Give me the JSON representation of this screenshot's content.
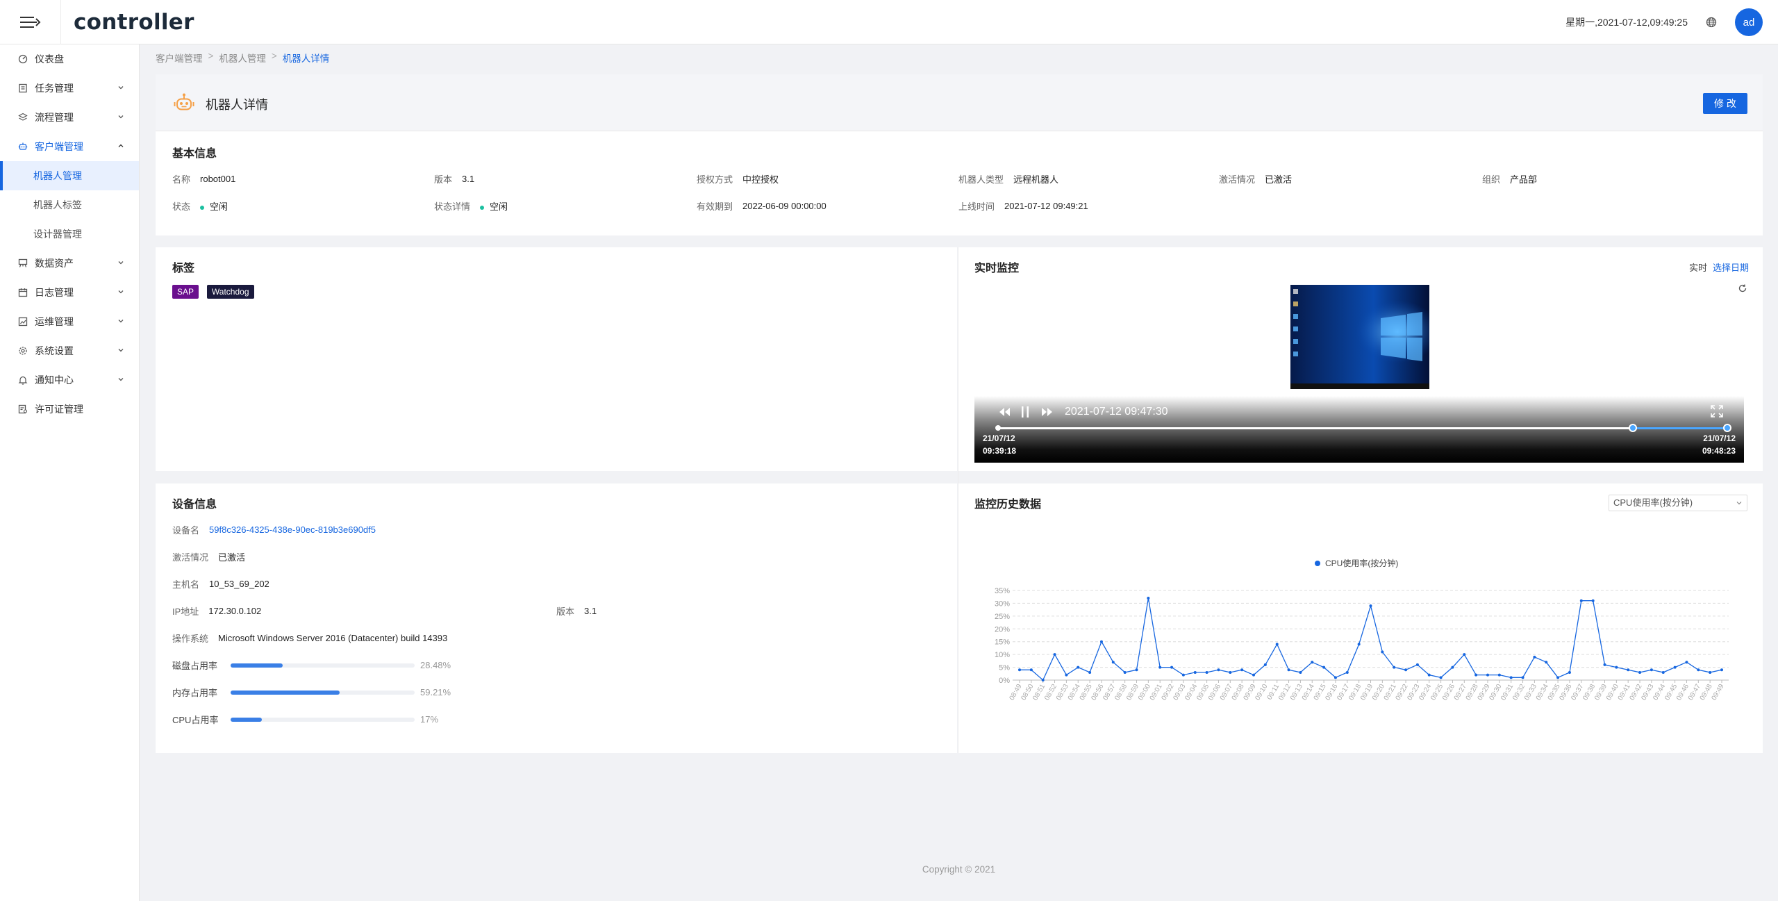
{
  "app": {
    "logo": "controller",
    "datetime": "星期一,2021-07-12,09:49:25",
    "avatar": "ad"
  },
  "sidebar": {
    "items": [
      {
        "label": "仪表盘"
      },
      {
        "label": "任务管理"
      },
      {
        "label": "流程管理"
      },
      {
        "label": "客户端管理"
      },
      {
        "label": "数据资产"
      },
      {
        "label": "日志管理"
      },
      {
        "label": "运维管理"
      },
      {
        "label": "系统设置"
      },
      {
        "label": "通知中心"
      },
      {
        "label": "许可证管理"
      }
    ],
    "subitems": [
      {
        "label": "机器人管理"
      },
      {
        "label": "机器人标签"
      },
      {
        "label": "设计器管理"
      }
    ]
  },
  "breadcrumb": {
    "level1": "客户端管理",
    "level2": "机器人管理",
    "current": "机器人详情",
    "sep": ">"
  },
  "header": {
    "title": "机器人详情",
    "edit_label": "修 改"
  },
  "basic": {
    "title": "基本信息",
    "name_k": "名称",
    "name_v": "robot001",
    "version_k": "版本",
    "version_v": "3.1",
    "auth_k": "授权方式",
    "auth_v": "中控授权",
    "type_k": "机器人类型",
    "type_v": "远程机器人",
    "activation_k": "激活情况",
    "activation_v": "已激活",
    "org_k": "组织",
    "org_v": "产品部",
    "status_k": "状态",
    "status_v": "空闲",
    "status_detail_k": "状态详情",
    "status_detail_v": "空闲",
    "expire_k": "有效期到",
    "expire_v": "2022-06-09 00:00:00",
    "online_k": "上线时间",
    "online_v": "2021-07-12 09:49:21"
  },
  "tags": {
    "title": "标签",
    "items": [
      {
        "label": "SAP",
        "color": "#6a0f8e"
      },
      {
        "label": "Watchdog",
        "color": "#1a1a3d"
      }
    ]
  },
  "monitor": {
    "title": "实时监控",
    "realtime_label": "实时",
    "choose_date_label": "选择日期",
    "player_time": "2021-07-12 09:47:30",
    "start_date": "21/07/12",
    "start_time": "09:39:18",
    "end_date": "21/07/12",
    "end_time": "09:48:23",
    "position": 0.87
  },
  "device": {
    "title": "设备信息",
    "name_k": "设备名",
    "name_v": "59f8c326-4325-438e-90ec-819b3e690df5",
    "activation_k": "激活情况",
    "activation_v": "已激活",
    "host_k": "主机名",
    "host_v": "10_53_69_202",
    "ip_k": "IP地址",
    "ip_v": "172.30.0.102",
    "version_k": "版本",
    "version_v": "3.1",
    "os_k": "操作系统",
    "os_v": "Microsoft Windows Server 2016 (Datacenter) build 14393",
    "disk_k": "磁盘占用率",
    "disk_pct": 28.48,
    "disk_label": "28.48%",
    "mem_k": "内存占用率",
    "mem_pct": 59.21,
    "mem_label": "59.21%",
    "cpu_k": "CPU占用率",
    "cpu_pct": 17,
    "cpu_label": "17%"
  },
  "history": {
    "title": "监控历史数据",
    "select_value": "CPU使用率(按分钟)"
  },
  "chart_data": {
    "type": "line",
    "legend": "CPU使用率(按分钟)",
    "legend_position": "top-center",
    "ylim": [
      0,
      35
    ],
    "yticks": [
      "35%",
      "30%",
      "25%",
      "20%",
      "15%",
      "10%",
      "5%",
      "0%"
    ],
    "grid": true,
    "color": "#1666e0",
    "x": [
      "08:49",
      "08:50",
      "08:51",
      "08:52",
      "08:53",
      "08:54",
      "08:55",
      "08:56",
      "08:57",
      "08:58",
      "08:59",
      "09:00",
      "09:01",
      "09:02",
      "09:03",
      "09:04",
      "09:05",
      "09:06",
      "09:07",
      "09:08",
      "09:09",
      "09:10",
      "09:11",
      "09:12",
      "09:13",
      "09:14",
      "09:15",
      "09:16",
      "09:17",
      "09:18",
      "09:19",
      "09:20",
      "09:21",
      "09:22",
      "09:23",
      "09:24",
      "09:25",
      "09:26",
      "09:27",
      "09:28",
      "09:29",
      "09:30",
      "09:31",
      "09:32",
      "09:33",
      "09:34",
      "09:35",
      "09:36",
      "09:37",
      "09:38",
      "09:39",
      "09:40",
      "09:41",
      "09:42",
      "09:43",
      "09:44",
      "09:45",
      "09:46",
      "09:47",
      "09:48",
      "09:49"
    ],
    "values": [
      4,
      4,
      0,
      10,
      2,
      5,
      3,
      15,
      7,
      3,
      4,
      32,
      5,
      5,
      2,
      3,
      3,
      4,
      3,
      4,
      2,
      6,
      14,
      4,
      3,
      7,
      5,
      1,
      3,
      14,
      29,
      11,
      5,
      4,
      6,
      2,
      1,
      5,
      10,
      2,
      2,
      2,
      1,
      1,
      9,
      7,
      1,
      3,
      31,
      31,
      6,
      5,
      4,
      3,
      4,
      3,
      5,
      7,
      4,
      3,
      4
    ]
  },
  "footer": {
    "copyright": "Copyright © 2021"
  }
}
